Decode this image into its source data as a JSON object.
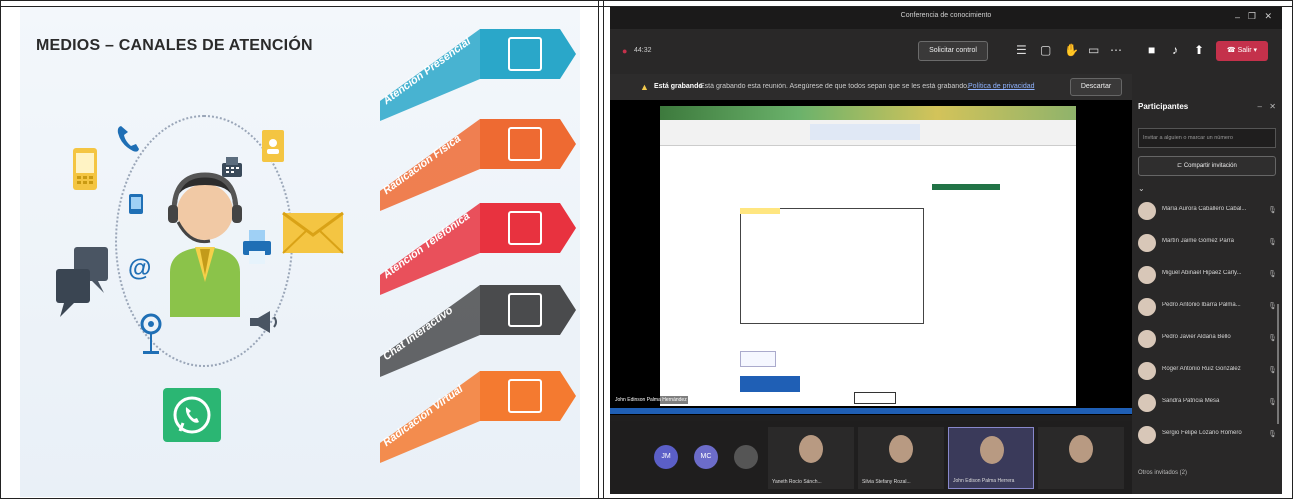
{
  "slide": {
    "title": "MEDIOS – CANALES  DE ATENCIÓN",
    "ribbons": [
      {
        "label": "Atención Presencial",
        "color": "#2aa7c9",
        "icon": "presenter-icon"
      },
      {
        "label": "Radicación Física",
        "color": "#ee6a32",
        "icon": "document-icon"
      },
      {
        "label": "Atención Telefónica",
        "color": "#e8323f",
        "icon": "phone-icon"
      },
      {
        "label": "Chat Interactivo",
        "color": "#4a4b4d",
        "icon": "screen-icon"
      },
      {
        "label": "Radicación Virtual",
        "color": "#f47a30",
        "icon": "chart-icon"
      }
    ],
    "icons": [
      "mobile-icon",
      "phone-icon",
      "fax-icon",
      "notebook-icon",
      "tablet-icon",
      "envelope-icon",
      "printer-icon",
      "at-icon",
      "chat-bubbles-icon",
      "megaphone-icon",
      "location-icon",
      "whatsapp-icon"
    ]
  },
  "teams": {
    "window_title": "Conferencia de conocimiento",
    "timer": "44:32",
    "request_control": "Solicitar control",
    "leave": "Salir",
    "recording_bold": "Está grabando",
    "recording_text": "Está grabando esta reunión. Asegúrese de que todos sepan que se les está grabando.",
    "privacy_link": "Política de privacidad",
    "dismiss": "Descartar",
    "presenter_label": "John Edinson Palma Hernández",
    "participants_title": "Participantes",
    "invite_placeholder": "Invitar a alguien o marcar un número",
    "share_invite": "Compartir invitación",
    "others_invited": "Otros invitados (2)",
    "participants": [
      "María Aurora Caballero Cabal...",
      "Martín Jaime Gómez Parra",
      "Miguel Abinael Hipaez Carly...",
      "Pedro Antonio Ibarra Palma...",
      "Pedro Javier Aldana Bello",
      "Roger Antonio Ruiz González",
      "Sandra Patricia Mesa",
      "Sergio Felipe Lozano Romero"
    ],
    "video_tiles": [
      {
        "label": "Yaneth Rocío Sánch...",
        "initials": ""
      },
      {
        "label": "Silvia Stefany Rozal...",
        "initials": ""
      },
      {
        "label": "John Edison Palma Herrera",
        "initials": ""
      },
      {
        "label": "",
        "initials": ""
      }
    ],
    "mini_avatars": [
      "JM",
      "MC",
      ""
    ],
    "accent": "#c4314b"
  }
}
